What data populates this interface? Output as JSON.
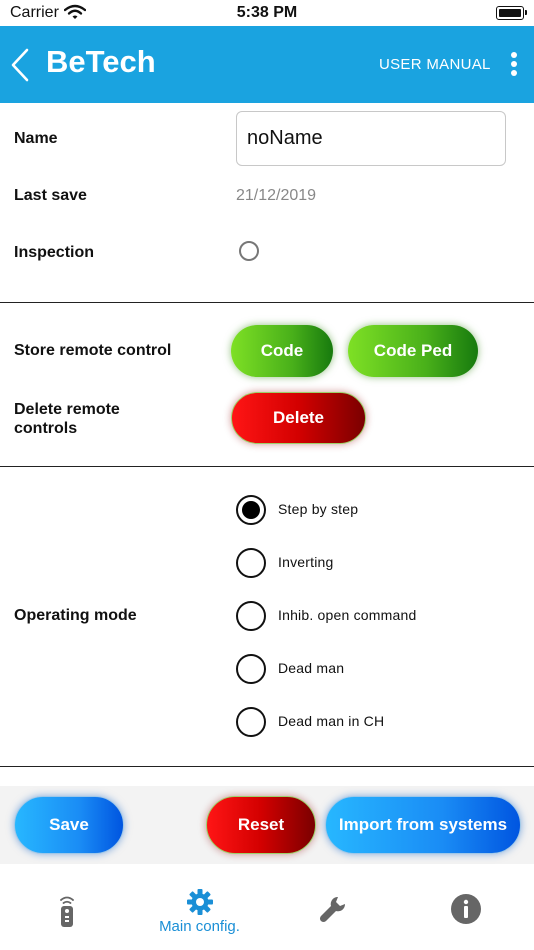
{
  "status_bar": {
    "carrier": "Carrier",
    "time": "5:38 PM"
  },
  "header": {
    "title": "BeTech",
    "user_manual": "USER MANUAL"
  },
  "form": {
    "name_label": "Name",
    "name_value": "noName",
    "last_save_label": "Last save",
    "last_save_value": "21/12/2019",
    "inspection_label": "Inspection"
  },
  "remote": {
    "store_label": "Store remote control",
    "code_button": "Code",
    "code_ped_button": "Code Ped",
    "delete_label": "Delete remote controls",
    "delete_button": "Delete"
  },
  "operating_mode": {
    "label": "Operating mode",
    "selected": "Step by step",
    "options": [
      "Step by step",
      "Inverting",
      "Inhib. open command",
      "Dead man",
      "Dead man in CH"
    ]
  },
  "actions": {
    "save": "Save",
    "reset": "Reset",
    "import": "Import from systems"
  },
  "tabs": [
    {
      "icon": "remote-control-icon",
      "label": ""
    },
    {
      "icon": "gear-icon",
      "label": "Main config."
    },
    {
      "icon": "wrench-icon",
      "label": ""
    },
    {
      "icon": "info-icon",
      "label": ""
    }
  ],
  "colors": {
    "accent": "#1aa3e0",
    "active_tab": "#1a8fd6",
    "inactive_tab": "#666666"
  }
}
